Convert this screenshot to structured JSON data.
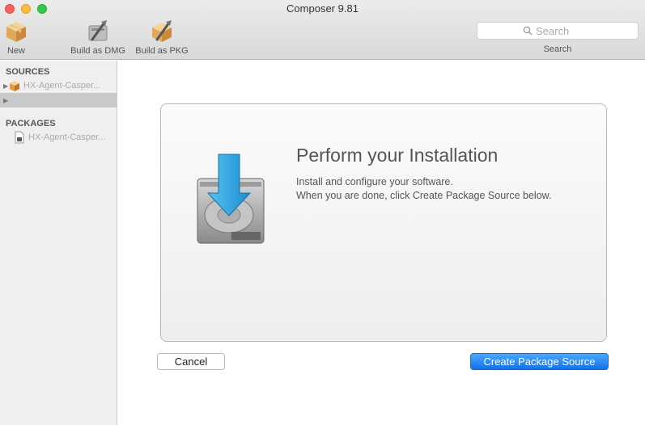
{
  "window": {
    "title": "Composer 9.81"
  },
  "toolbar": {
    "items": [
      {
        "label": "New",
        "icon": "package-box-icon"
      },
      {
        "label": "Build as DMG",
        "icon": "dmg-tools-icon"
      },
      {
        "label": "Build as PKG",
        "icon": "pkg-tools-icon"
      }
    ],
    "search": {
      "placeholder": "Search",
      "label": "Search"
    }
  },
  "sidebar": {
    "sources_header": "SOURCES",
    "sources": [
      {
        "label": "HX-Agent-Casper...",
        "icon": "package-box-icon"
      },
      {
        "label": ""
      }
    ],
    "packages_header": "PACKAGES",
    "packages": [
      {
        "label": "HX-Agent-Casper...",
        "icon": "package-file-icon"
      }
    ]
  },
  "main": {
    "title": "Perform your Installation",
    "line1": "Install and configure your software.",
    "line2": "When you are done, click Create Package Source below.",
    "cancel_label": "Cancel",
    "create_label": "Create Package Source"
  },
  "colors": {
    "accent": "#1a7ef2",
    "close": "#fc605c",
    "minimize": "#fdbc40",
    "maximize": "#34c84a"
  }
}
